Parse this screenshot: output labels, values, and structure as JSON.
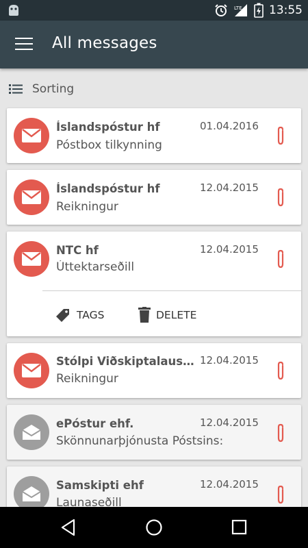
{
  "status_bar": {
    "time": "13:55",
    "network": "LTE",
    "icons": [
      "android-icon",
      "alarm-icon",
      "signal-icon",
      "battery-icon"
    ]
  },
  "app_bar": {
    "title": "All messages",
    "menu_icon": "hamburger-menu-icon"
  },
  "sorting": {
    "label": "Sorting",
    "icon": "list-icon"
  },
  "messages": [
    {
      "sender": "Íslandspóstur hf",
      "subject": "Póstbox tilkynning",
      "date": "01.04.2016",
      "state": "unread",
      "attachment": true
    },
    {
      "sender": "Íslandspóstur hf",
      "subject": "Reikningur",
      "date": "12.04.2015",
      "state": "unread",
      "attachment": true
    },
    {
      "sender": "NTC hf",
      "subject": "Úttektarseðill",
      "date": "12.04.2015",
      "state": "unread",
      "attachment": true,
      "expanded": true
    },
    {
      "sender": "Stólpi Viðskiptalausnir ehf",
      "subject": "Reikningur",
      "date": "12.04.2015",
      "state": "unread",
      "attachment": true
    },
    {
      "sender": "ePóstur ehf.",
      "subject": "Skönnunarþjónusta Póstsins:",
      "date": "12.04.2015",
      "state": "read",
      "attachment": true
    },
    {
      "sender": "Samskipti ehf",
      "subject": "Launaseðill",
      "date": "12.04.2015",
      "state": "read",
      "attachment": true
    }
  ],
  "expanded_actions": {
    "tags_label": "TAGS",
    "delete_label": "DELETE"
  },
  "colors": {
    "status_bar": "#263238",
    "app_bar": "#37474f",
    "unread_avatar": "#e35a4f",
    "read_avatar": "#9e9e9e",
    "attachment": "#e35a4f",
    "background": "#e6e6e6"
  },
  "nav_bar": {
    "buttons": [
      "back-icon",
      "home-icon",
      "recents-icon"
    ]
  }
}
